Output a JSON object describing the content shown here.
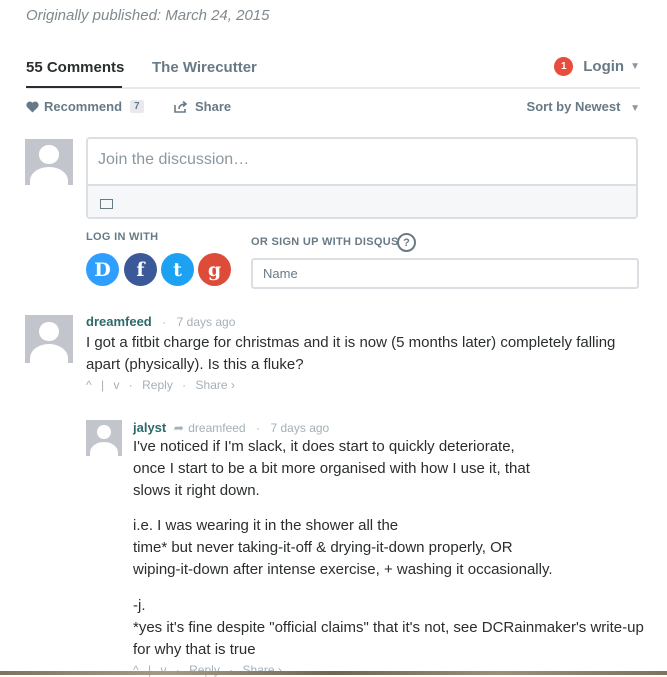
{
  "published": "Originally published: March 24, 2015",
  "tabs": {
    "comments": "55 Comments",
    "site": "The Wirecutter"
  },
  "login": {
    "badge": "1",
    "label": "Login"
  },
  "actions": {
    "recommend": "Recommend",
    "recommend_count": "7",
    "share": "Share",
    "sort": "Sort by Newest"
  },
  "composer": {
    "placeholder": "Join the discussion…"
  },
  "auth": {
    "log_in_with": "LOG IN WITH",
    "sign_up": "OR SIGN UP WITH DISQUS",
    "help": "?",
    "name_placeholder": "Name",
    "services": [
      {
        "letter": "D",
        "color": "#2e9fff"
      },
      {
        "letter": "f",
        "color": "#3b5998"
      },
      {
        "letter": "t",
        "color": "#1da1f2"
      },
      {
        "letter": "g",
        "color": "#dd4b39"
      }
    ]
  },
  "comments": [
    {
      "author": "dreamfeed",
      "time": "7 days ago",
      "text": "I got a fitbit charge for christmas and it is now (5 months later) completely falling apart (physically). Is this a fluke?",
      "reply": "Reply",
      "share": "Share ›"
    },
    {
      "author": "jalyst",
      "reply_to": "dreamfeed",
      "time": "7 days ago",
      "lines": [
        "I've noticed if I'm slack, it does start to quickly deteriorate,",
        "once I start to be a bit more organised with how I use it, that",
        "slows it right down.",
        "i.e. I was wearing it in the shower all the",
        "time* but never taking-it-off & drying-it-down properly, OR",
        "wiping-it-down after intense exercise, + washing it occasionally.",
        "-j.",
        "*yes it's fine despite \"official claims\" that it's not, see DCRainmaker's write-up",
        "for why that is true"
      ],
      "reply": "Reply",
      "share": "Share ›"
    }
  ]
}
